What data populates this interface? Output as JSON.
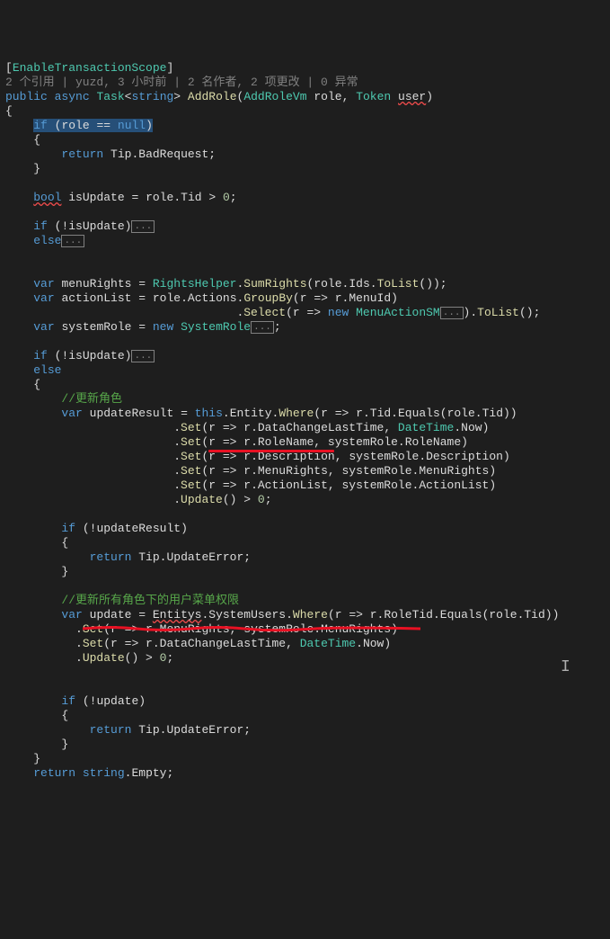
{
  "attr": {
    "name": "EnableTransactionScope"
  },
  "codelens": "2 个引用 | yuzd, 3 小时前 | 2 名作者, 2 项更改 | 0 异常",
  "sig": {
    "kw_public": "public",
    "kw_async": "async",
    "task": "Task",
    "string": "string",
    "method": "AddRole",
    "paramType1": "AddRoleVm",
    "paramName1": "role",
    "paramType2": "Token",
    "paramName2": "user"
  },
  "l_brace": "{",
  "nullcheck": {
    "kw_if": "if",
    "cond_var": "role",
    "cond_op": "==",
    "cond_null": "null"
  },
  "ret1": {
    "kw_return": "return",
    "obj": "Tip",
    "prop": "BadRequest"
  },
  "isupdate_line": {
    "kw_bool": "bool",
    "var": "isUpdate",
    "eq": "=",
    "obj": "role",
    "prop": "Tid",
    "op": ">",
    "zero": "0"
  },
  "if_isupdate": {
    "kw_if": "if",
    "cond": "!isUpdate",
    "collapse": "..."
  },
  "else_isupdate": {
    "kw_else": "else",
    "collapse": "..."
  },
  "menuRights": {
    "kw_var": "var",
    "name": "menuRights",
    "helper": "RightsHelper",
    "m1": "SumRights",
    "obj": "role",
    "prop": "Ids",
    "m2": "ToList"
  },
  "actionList": {
    "kw_var": "var",
    "name": "actionList",
    "obj": "role",
    "prop": "Actions",
    "m1": "GroupBy",
    "lambda": "r => r.MenuId",
    "m2": "Select",
    "lambda2_pre": "r => ",
    "kw_new": "new",
    "type": "MenuActionSM",
    "collapse": "...",
    "m3": "ToList"
  },
  "systemRole": {
    "kw_var": "var",
    "name": "systemRole",
    "kw_new": "new",
    "type": "SystemRole",
    "collapse": "..."
  },
  "if_isupdate2": {
    "kw_if": "if",
    "cond": "!isUpdate",
    "collapse": "..."
  },
  "else2": "else",
  "comment1": "//更新角色",
  "updateResult": {
    "kw_var": "var",
    "name": "updateResult",
    "kw_this": "this",
    "entity": "Entity",
    "where": "Where",
    "where_lambda": "r => r.Tid.Equals(role.Tid)",
    "set": "Set",
    "s1a": "r => r.DataChangeLastTime",
    "s1b_type": "DateTime",
    "s1b_prop": "Now",
    "s2a": "r => r.RoleName",
    "s2b": "systemRole.RoleName",
    "s3a": "r => r.Description",
    "s3b": "systemRole.Description",
    "s4a": "r => r.MenuRights",
    "s4b": "systemRole.MenuRights",
    "s5a": "r => r.ActionList",
    "s5b": "systemRole.ActionList",
    "update": "Update",
    "gt": ">",
    "zero": "0"
  },
  "if_updres": {
    "kw_if": "if",
    "cond": "!updateResult"
  },
  "ret2": {
    "kw_return": "return",
    "obj": "Tip",
    "prop": "UpdateError"
  },
  "comment2": "//更新所有角色下的用户菜单权限",
  "update2": {
    "kw_var": "var",
    "name": "update",
    "entitys": "Entitys",
    "sysusers": "SystemUsers",
    "where": "Where",
    "where_lambda": "r => r.RoleTid.Equals(role.Tid)",
    "set": "Set",
    "s1a": "r => r.MenuRights",
    "s1b": "systemRole.MenuRights",
    "s2a": "r => r.DataChangeLastTime",
    "s2b_type": "DateTime",
    "s2b_prop": "Now",
    "update": "Update",
    "gt": ">",
    "zero": "0"
  },
  "if_update2": {
    "kw_if": "if",
    "cond": "!update"
  },
  "ret3": {
    "kw_return": "return",
    "obj": "Tip",
    "prop": "UpdateError"
  },
  "r_brace_inner": "}",
  "ret_final": {
    "kw_return": "return",
    "kw_string": "string",
    "prop": "Empty"
  }
}
